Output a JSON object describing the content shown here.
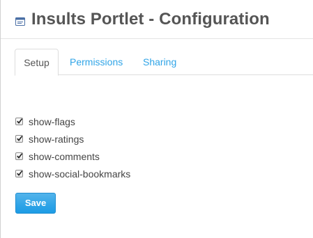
{
  "header": {
    "icon": "portlet-window-icon",
    "title": "Insults Portlet - Configuration"
  },
  "tabs": [
    {
      "label": "Setup",
      "active": true
    },
    {
      "label": "Permissions",
      "active": false
    },
    {
      "label": "Sharing",
      "active": false
    }
  ],
  "options": [
    {
      "label": "show-flags",
      "checked": true
    },
    {
      "label": "show-ratings",
      "checked": true
    },
    {
      "label": "show-comments",
      "checked": true
    },
    {
      "label": "show-social-bookmarks",
      "checked": true
    }
  ],
  "actions": {
    "save_label": "Save"
  },
  "colors": {
    "accent": "#2fa4e7",
    "title": "#555555"
  }
}
